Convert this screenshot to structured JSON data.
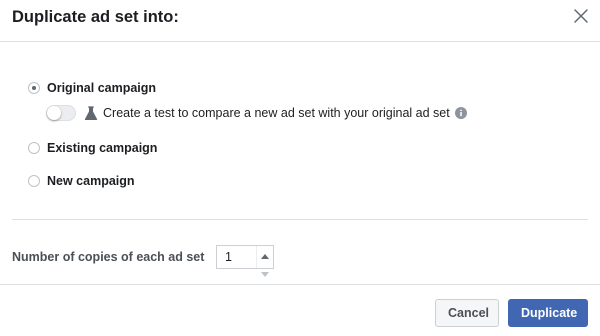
{
  "dialog": {
    "title": "Duplicate ad set into:",
    "close_icon": "close-icon"
  },
  "options": [
    {
      "label": "Original campaign",
      "selected": true
    },
    {
      "label": "Existing campaign",
      "selected": false
    },
    {
      "label": "New campaign",
      "selected": false
    }
  ],
  "test_toggle": {
    "enabled": false,
    "text": "Create a test to compare a new ad set with your original ad set",
    "icon": "flask-icon",
    "info_icon": "info-icon"
  },
  "copies": {
    "label": "Number of copies of each ad set",
    "value": "1"
  },
  "footer": {
    "cancel_label": "Cancel",
    "primary_label": "Duplicate"
  },
  "colors": {
    "primary": "#4267b2",
    "border": "#dddfe2",
    "text": "#1c1e21"
  }
}
